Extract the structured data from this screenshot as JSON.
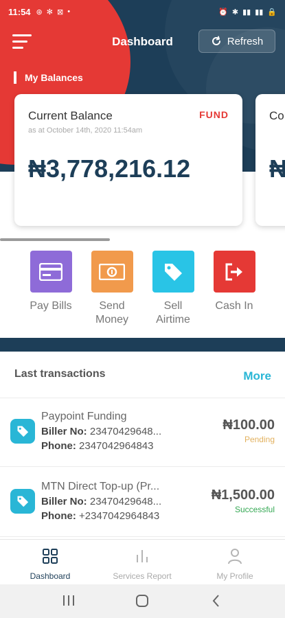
{
  "status_bar": {
    "time": "11:54",
    "left_icons": [
      "⊛",
      "✻",
      "⊠",
      "•"
    ],
    "right_icons": [
      "⏰",
      "✱",
      "▮▮",
      "▮▮",
      "🔒"
    ]
  },
  "header": {
    "title": "Dashboard",
    "refresh_label": "Refresh"
  },
  "balances": {
    "section_title": "My Balances",
    "card": {
      "title": "Current Balance",
      "subtitle": "as at October 14th, 2020 11:54am",
      "action": "FUND",
      "amount": "₦3,778,216.12"
    },
    "peek_card": {
      "title": "Co",
      "amount": "₦"
    }
  },
  "actions": [
    {
      "label": "Pay Bills",
      "icon": "credit-card-icon",
      "color": "#8e6bd8"
    },
    {
      "label": "Send Money",
      "icon": "banknote-icon",
      "color": "#f19a4c"
    },
    {
      "label": "Sell Airtime",
      "icon": "tag-icon",
      "color": "#29c4e6"
    },
    {
      "label": "Cash In",
      "icon": "exit-arrow-icon",
      "color": "#e53935"
    }
  ],
  "transactions": {
    "title": "Last transactions",
    "more_label": "More",
    "items": [
      {
        "name": "Paypoint Funding",
        "biller_label": "Biller No:",
        "biller_value": "23470429648...",
        "phone_label": "Phone:",
        "phone_value": "2347042964843",
        "amount": "₦100.00",
        "status": "Pending",
        "status_color": "#e2b15e"
      },
      {
        "name": "MTN Direct Top-up (Pr...",
        "biller_label": "Biller No:",
        "biller_value": "23470429648...",
        "phone_label": "Phone:",
        "phone_value": "+2347042964843",
        "amount": "₦1,500.00",
        "status": "Successful",
        "status_color": "#34a853"
      }
    ]
  },
  "bottom_nav": [
    {
      "label": "Dashboard",
      "icon": "grid-icon",
      "active": true
    },
    {
      "label": "Services Report",
      "icon": "bar-chart-icon",
      "active": false
    },
    {
      "label": "My Profile",
      "icon": "user-icon",
      "active": false
    }
  ],
  "colors": {
    "navy": "#1d3e58",
    "red": "#e53935",
    "accent": "#29b6d6"
  }
}
